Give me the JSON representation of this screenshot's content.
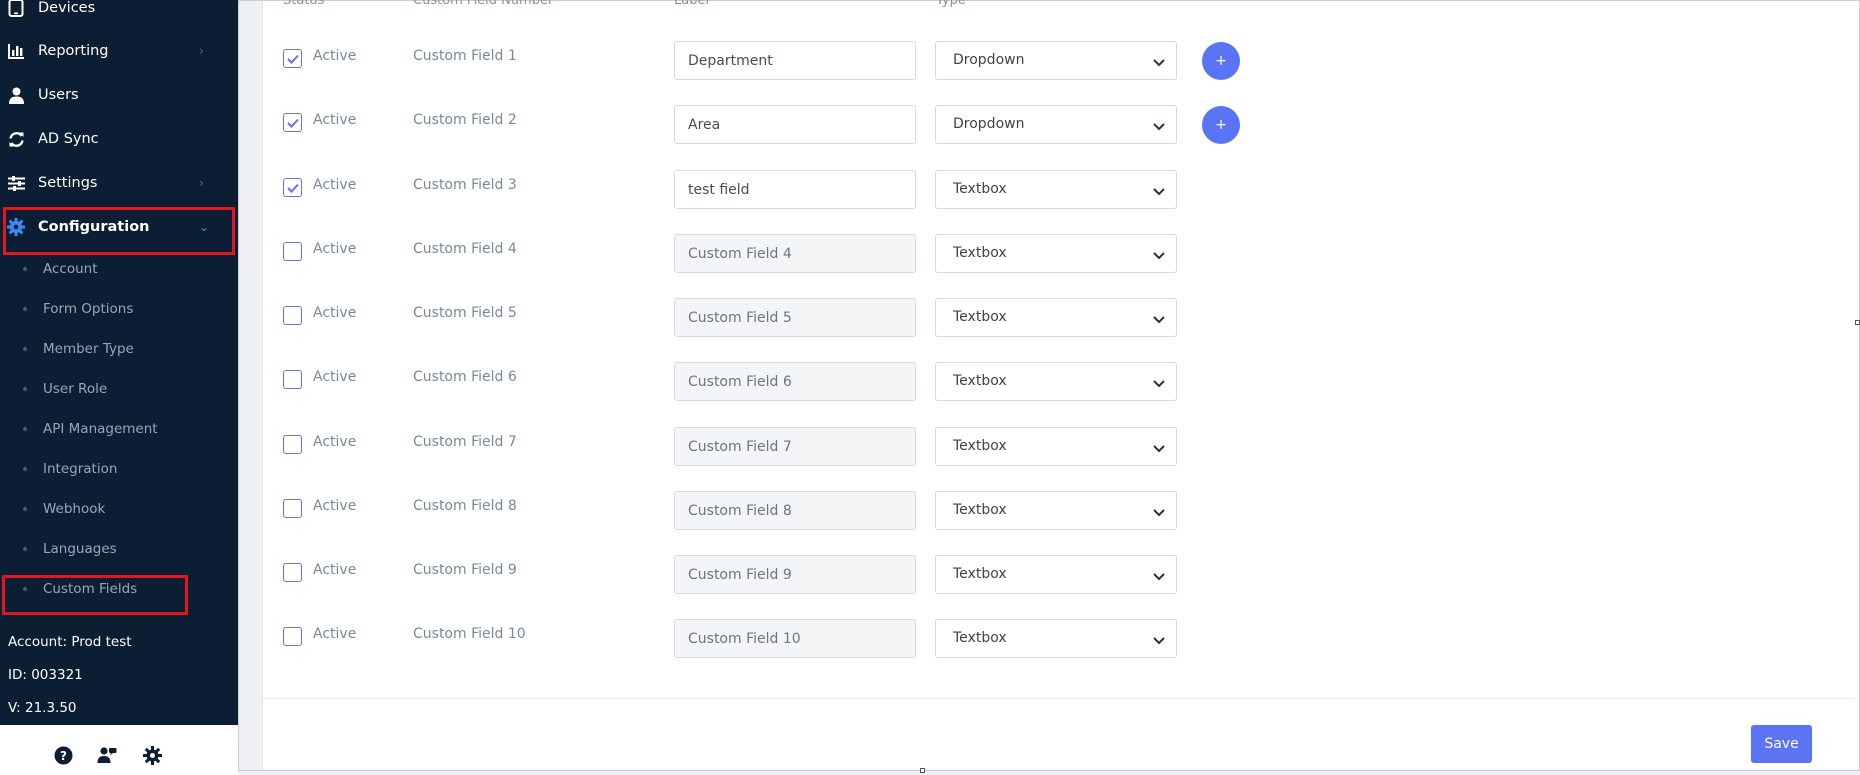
{
  "sidebar": {
    "nav": [
      {
        "label": "Devices",
        "icon": "tablet-icon",
        "chevron": false
      },
      {
        "label": "Reporting",
        "icon": "bar-chart-icon",
        "chevron": true
      },
      {
        "label": "Users",
        "icon": "user-icon",
        "chevron": false
      },
      {
        "label": "AD Sync",
        "icon": "sync-icon",
        "chevron": false
      },
      {
        "label": "Settings",
        "icon": "sliders-icon",
        "chevron": true
      },
      {
        "label": "Configuration",
        "icon": "gear-icon",
        "chevron": true,
        "active": true
      }
    ],
    "submenu": [
      {
        "label": "Account"
      },
      {
        "label": "Form Options"
      },
      {
        "label": "Member Type"
      },
      {
        "label": "User Role"
      },
      {
        "label": "API Management"
      },
      {
        "label": "Integration"
      },
      {
        "label": "Webhook"
      },
      {
        "label": "Languages"
      },
      {
        "label": "Custom Fields"
      }
    ],
    "account_info": {
      "account": "Account: Prod test",
      "id": "ID: 003321",
      "version": "V: 21.3.50"
    },
    "footer_icons": [
      "help-icon",
      "user-switch-icon",
      "settings-gear-icon"
    ]
  },
  "table": {
    "headers": {
      "status": "Status",
      "field_number": "Custom Field Number",
      "label": "Label",
      "type": "Type"
    },
    "rows": [
      {
        "checked": true,
        "status": "Active",
        "field_number": "Custom Field 1",
        "label": "Department",
        "type": "Dropdown",
        "editable": true,
        "has_add": true
      },
      {
        "checked": true,
        "status": "Active",
        "field_number": "Custom Field 2",
        "label": "Area",
        "type": "Dropdown",
        "editable": true,
        "has_add": true
      },
      {
        "checked": true,
        "status": "Active",
        "field_number": "Custom Field 3",
        "label": "test field",
        "type": "Textbox",
        "editable": true,
        "has_add": false
      },
      {
        "checked": false,
        "status": "Active",
        "field_number": "Custom Field 4",
        "label": "Custom Field 4",
        "type": "Textbox",
        "editable": false,
        "has_add": false
      },
      {
        "checked": false,
        "status": "Active",
        "field_number": "Custom Field 5",
        "label": "Custom Field 5",
        "type": "Textbox",
        "editable": false,
        "has_add": false
      },
      {
        "checked": false,
        "status": "Active",
        "field_number": "Custom Field 6",
        "label": "Custom Field 6",
        "type": "Textbox",
        "editable": false,
        "has_add": false
      },
      {
        "checked": false,
        "status": "Active",
        "field_number": "Custom Field 7",
        "label": "Custom Field 7",
        "type": "Textbox",
        "editable": false,
        "has_add": false
      },
      {
        "checked": false,
        "status": "Active",
        "field_number": "Custom Field 8",
        "label": "Custom Field 8",
        "type": "Textbox",
        "editable": false,
        "has_add": false
      },
      {
        "checked": false,
        "status": "Active",
        "field_number": "Custom Field 9",
        "label": "Custom Field 9",
        "type": "Textbox",
        "editable": false,
        "has_add": false
      },
      {
        "checked": false,
        "status": "Active",
        "field_number": "Custom Field 10",
        "label": "Custom Field 10",
        "type": "Textbox",
        "editable": false,
        "has_add": false
      }
    ],
    "add_label": "+"
  },
  "actions": {
    "save_label": "Save"
  },
  "colors": {
    "sidebar_bg": "#0c1e33",
    "accent": "#5b73f5",
    "highlight_red": "#e3161e"
  }
}
